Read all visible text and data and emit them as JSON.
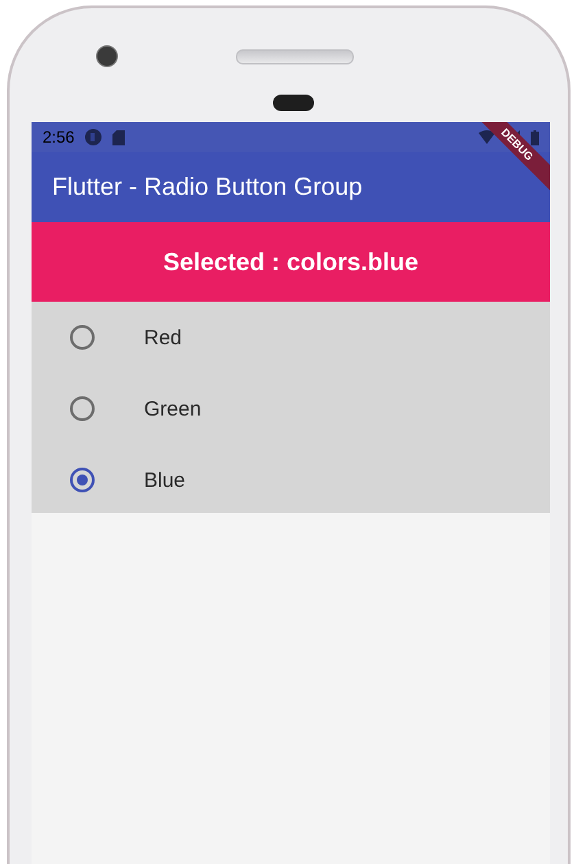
{
  "status_bar": {
    "time": "2:56"
  },
  "debug_banner": "DEBUG",
  "app_bar": {
    "title": "Flutter - Radio Button Group"
  },
  "banner": {
    "text": "Selected : colors.blue"
  },
  "options": [
    {
      "label": "Red",
      "selected": false
    },
    {
      "label": "Green",
      "selected": false
    },
    {
      "label": "Blue",
      "selected": true
    }
  ]
}
